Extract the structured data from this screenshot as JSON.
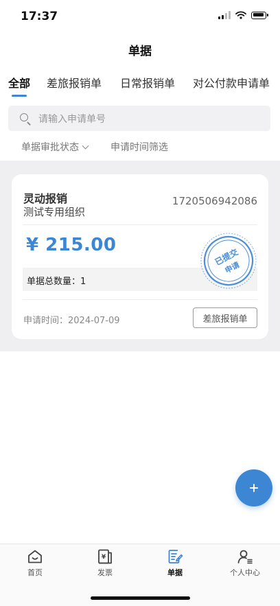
{
  "status_bar": {
    "time": "17:37"
  },
  "header": {
    "title": "单据"
  },
  "tabs": [
    {
      "label": "全部",
      "active": true
    },
    {
      "label": "差旅报销单",
      "active": false
    },
    {
      "label": "日常报销单",
      "active": false
    },
    {
      "label": "对公付款申请单",
      "active": false
    }
  ],
  "search": {
    "placeholder": "请输入申请单号",
    "value": ""
  },
  "filters": {
    "status_label": "单据审批状态",
    "time_label": "申请时间筛选"
  },
  "document": {
    "title": "灵动报销",
    "organization": "测试专用组织",
    "number": "1720506942086",
    "amount": "¥ 215.00",
    "count_label": "单据总数量：1",
    "stamp_lines": [
      "已提交",
      "申请"
    ],
    "apply_time": "申请时间：2024-07-09",
    "type_label": "差旅报销单"
  },
  "fab": {
    "icon": "plus-icon"
  },
  "tabbar": {
    "items": [
      {
        "label": "首页",
        "icon": "home-icon",
        "active": false
      },
      {
        "label": "发票",
        "icon": "invoice-icon",
        "active": false
      },
      {
        "label": "单据",
        "icon": "document-edit-icon",
        "active": true
      },
      {
        "label": "个人中心",
        "icon": "profile-icon",
        "active": false
      }
    ]
  },
  "colors": {
    "accent": "#3d86d3",
    "stamp": "#4d8fd6",
    "list_background": "#efeff1"
  }
}
